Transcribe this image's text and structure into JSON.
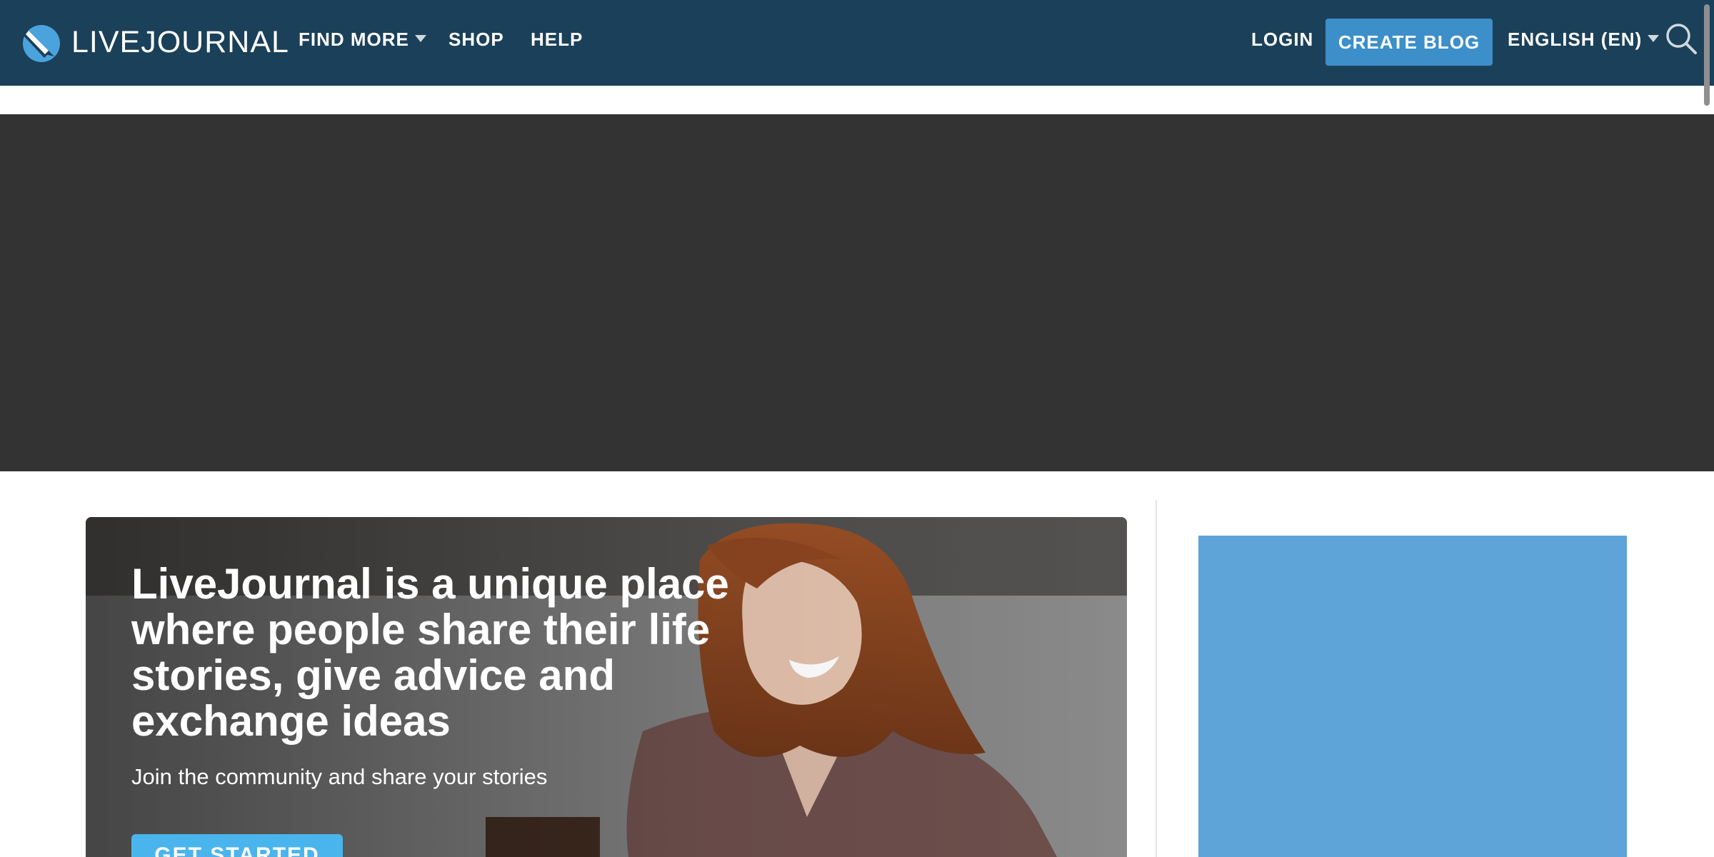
{
  "header": {
    "logo_text": "LIVEJOURNAL",
    "nav": [
      {
        "label": "FIND MORE",
        "has_dropdown": true
      },
      {
        "label": "SHOP",
        "has_dropdown": false
      },
      {
        "label": "HELP",
        "has_dropdown": false
      }
    ],
    "login_label": "LOGIN",
    "create_blog_label": "CREATE BLOG",
    "language_label": "ENGLISH (EN)",
    "search_icon": "search-icon"
  },
  "hero": {
    "title": "LiveJournal is a unique place where people share their life stories, give advice and exchange ideas",
    "subtitle": "Join the community and share your stories",
    "cta_label": "GET STARTED"
  },
  "colors": {
    "header_bg": "#1b4059",
    "accent": "#3c8fc8",
    "banner_bg": "#333333",
    "side_ad_bg": "#5ea4d8",
    "cta_bg": "#4ab5ec"
  }
}
